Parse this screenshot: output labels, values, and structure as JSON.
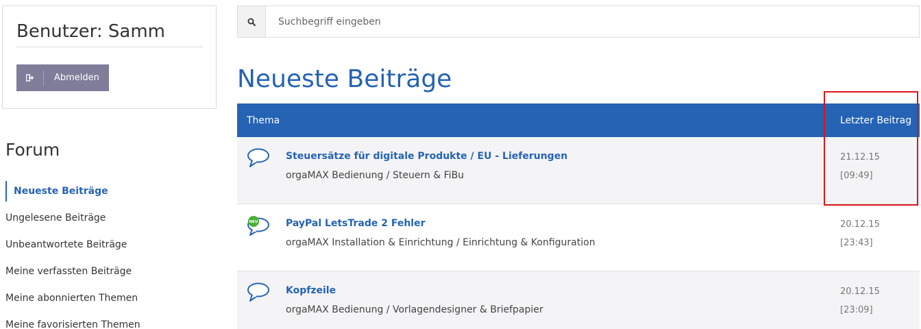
{
  "user_panel": {
    "title": "Benutzer: Samm",
    "logout_label": "Abmelden"
  },
  "sidebar": {
    "heading": "Forum",
    "items": [
      {
        "label": "Neueste Beiträge",
        "active": true
      },
      {
        "label": "Ungelesene Beiträge"
      },
      {
        "label": "Unbeantwortete Beiträge"
      },
      {
        "label": "Meine verfassten Beiträge"
      },
      {
        "label": "Meine abonnierten Themen"
      },
      {
        "label": "Meine favorisierten Themen"
      }
    ]
  },
  "search": {
    "placeholder": "Suchbegriff eingeben",
    "value": ""
  },
  "main": {
    "title": "Neueste Beiträge",
    "table": {
      "headers": {
        "topic": "Thema",
        "last_post": "Letzter Beitrag"
      },
      "rows": [
        {
          "topic": "Steuersätze für digitale Produkte / EU - Lieferungen",
          "category": "orgaMAX Bedienung / Steuern & FiBu",
          "date": "21.12.15",
          "time": "[09:49]",
          "icon": "speech-bubble-icon"
        },
        {
          "topic": "PayPal LetsTrade 2 Fehler",
          "category": "orgaMAX Installation & Einrichtung / Einrichtung & Konfiguration",
          "date": "20.12.15",
          "time": "[23:43]",
          "icon": "new-speech-bubble-icon",
          "badge": "NEU"
        },
        {
          "topic": "Kopfzeile",
          "category": "orgaMAX Bedienung / Vorlagendesigner & Briefpapier",
          "date": "20.12.15",
          "time": "[23:09]",
          "icon": "speech-bubble-icon"
        }
      ]
    }
  },
  "colors": {
    "accent": "#2563b4",
    "logout_button": "#7f7d9a",
    "highlight": "#d9161a",
    "new_badge": "#4caf32"
  }
}
